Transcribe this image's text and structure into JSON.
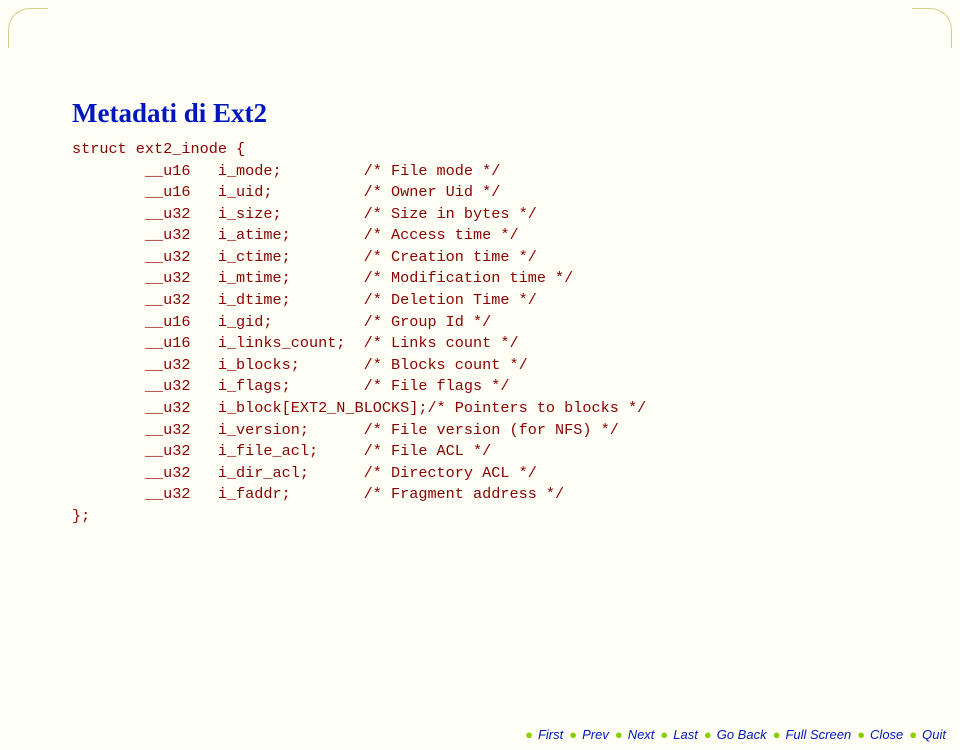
{
  "title": "Metadati di Ext2",
  "code": {
    "open": "struct ext2_inode {",
    "lines": [
      {
        "type": "__u16",
        "name": "i_mode;",
        "comment": "/* File mode */"
      },
      {
        "type": "__u16",
        "name": "i_uid;",
        "comment": "/* Owner Uid */"
      },
      {
        "type": "__u32",
        "name": "i_size;",
        "comment": "/* Size in bytes */"
      },
      {
        "type": "__u32",
        "name": "i_atime;",
        "comment": "/* Access time */"
      },
      {
        "type": "__u32",
        "name": "i_ctime;",
        "comment": "/* Creation time */"
      },
      {
        "type": "__u32",
        "name": "i_mtime;",
        "comment": "/* Modification time */"
      },
      {
        "type": "__u32",
        "name": "i_dtime;",
        "comment": "/* Deletion Time */"
      },
      {
        "type": "__u16",
        "name": "i_gid;",
        "comment": "/* Group Id */"
      },
      {
        "type": "__u16",
        "name": "i_links_count;",
        "comment": "/* Links count */"
      },
      {
        "type": "__u32",
        "name": "i_blocks;",
        "comment": "/* Blocks count */"
      },
      {
        "type": "__u32",
        "name": "i_flags;",
        "comment": "/* File flags */"
      },
      {
        "type": "__u32",
        "name": "i_block[EXT2_N_BLOCKS];",
        "comment": "/* Pointers to blocks */"
      },
      {
        "type": "__u32",
        "name": "i_version;",
        "comment": "/* File version (for NFS) */"
      },
      {
        "type": "__u32",
        "name": "i_file_acl;",
        "comment": "/* File ACL */"
      },
      {
        "type": "__u32",
        "name": "i_dir_acl;",
        "comment": "/* Directory ACL */"
      },
      {
        "type": "__u32",
        "name": "i_faddr;",
        "comment": "/* Fragment address */"
      }
    ],
    "close": "};"
  },
  "nav": [
    "First",
    "Prev",
    "Next",
    "Last",
    "Go Back",
    "Full Screen",
    "Close",
    "Quit"
  ]
}
